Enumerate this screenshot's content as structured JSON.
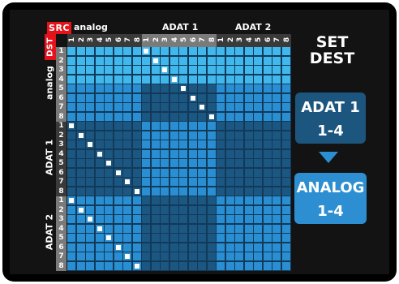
{
  "matrix": {
    "src_label": "SRC",
    "dst_label": "DST",
    "column_groups": [
      {
        "name": "analog",
        "channels": [
          "1",
          "2",
          "3",
          "4",
          "5",
          "6",
          "7",
          "8"
        ]
      },
      {
        "name": "ADAT 1",
        "channels": [
          "1",
          "2",
          "3",
          "4",
          "5",
          "6",
          "7",
          "8"
        ]
      },
      {
        "name": "ADAT 2",
        "channels": [
          "1",
          "2",
          "3",
          "4",
          "5",
          "6",
          "7",
          "8"
        ]
      }
    ],
    "row_groups": [
      {
        "name": "analog",
        "channels": [
          "1",
          "2",
          "3",
          "4",
          "5",
          "6",
          "7",
          "8"
        ]
      },
      {
        "name": "ADAT 1",
        "channels": [
          "1",
          "2",
          "3",
          "4",
          "5",
          "6",
          "7",
          "8"
        ]
      },
      {
        "name": "ADAT 2",
        "channels": [
          "1",
          "2",
          "3",
          "4",
          "5",
          "6",
          "7",
          "8"
        ]
      }
    ],
    "routes": [
      {
        "dest_group": "analog",
        "dest_ch": 1,
        "src_group": "ADAT 1",
        "src_ch": 1
      },
      {
        "dest_group": "analog",
        "dest_ch": 2,
        "src_group": "ADAT 1",
        "src_ch": 2
      },
      {
        "dest_group": "analog",
        "dest_ch": 3,
        "src_group": "ADAT 1",
        "src_ch": 3
      },
      {
        "dest_group": "analog",
        "dest_ch": 4,
        "src_group": "ADAT 1",
        "src_ch": 4
      },
      {
        "dest_group": "analog",
        "dest_ch": 5,
        "src_group": "ADAT 1",
        "src_ch": 5
      },
      {
        "dest_group": "analog",
        "dest_ch": 6,
        "src_group": "ADAT 1",
        "src_ch": 6
      },
      {
        "dest_group": "analog",
        "dest_ch": 7,
        "src_group": "ADAT 1",
        "src_ch": 7
      },
      {
        "dest_group": "analog",
        "dest_ch": 8,
        "src_group": "ADAT 1",
        "src_ch": 8
      },
      {
        "dest_group": "ADAT 1",
        "dest_ch": 1,
        "src_group": "analog",
        "src_ch": 1
      },
      {
        "dest_group": "ADAT 1",
        "dest_ch": 2,
        "src_group": "analog",
        "src_ch": 2
      },
      {
        "dest_group": "ADAT 1",
        "dest_ch": 3,
        "src_group": "analog",
        "src_ch": 3
      },
      {
        "dest_group": "ADAT 1",
        "dest_ch": 4,
        "src_group": "analog",
        "src_ch": 4
      },
      {
        "dest_group": "ADAT 1",
        "dest_ch": 5,
        "src_group": "analog",
        "src_ch": 5
      },
      {
        "dest_group": "ADAT 1",
        "dest_ch": 6,
        "src_group": "analog",
        "src_ch": 6
      },
      {
        "dest_group": "ADAT 1",
        "dest_ch": 7,
        "src_group": "analog",
        "src_ch": 7
      },
      {
        "dest_group": "ADAT 1",
        "dest_ch": 8,
        "src_group": "analog",
        "src_ch": 8
      },
      {
        "dest_group": "ADAT 2",
        "dest_ch": 1,
        "src_group": "analog",
        "src_ch": 1
      },
      {
        "dest_group": "ADAT 2",
        "dest_ch": 2,
        "src_group": "analog",
        "src_ch": 2
      },
      {
        "dest_group": "ADAT 2",
        "dest_ch": 3,
        "src_group": "analog",
        "src_ch": 3
      },
      {
        "dest_group": "ADAT 2",
        "dest_ch": 4,
        "src_group": "analog",
        "src_ch": 4
      },
      {
        "dest_group": "ADAT 2",
        "dest_ch": 5,
        "src_group": "analog",
        "src_ch": 5
      },
      {
        "dest_group": "ADAT 2",
        "dest_ch": 6,
        "src_group": "analog",
        "src_ch": 6
      },
      {
        "dest_group": "ADAT 2",
        "dest_ch": 7,
        "src_group": "analog",
        "src_ch": 7
      },
      {
        "dest_group": "ADAT 2",
        "dest_ch": 8,
        "src_group": "analog",
        "src_ch": 8
      }
    ],
    "highlight": {
      "dest_group": "analog",
      "dest_channels": "1-4"
    },
    "colors": {
      "block_light": "#2a8fd2",
      "block_dark": "#1c5782",
      "highlight": "#40b8ec",
      "gridline": "#11395a",
      "cell_active": "#ffffff",
      "tab_red": "#e3121b",
      "header_gray": "#7a7a7a"
    }
  },
  "side_panel": {
    "title_line1": "SET",
    "title_line2": "DEST",
    "source": {
      "line1": "ADAT 1",
      "line2": "1-4"
    },
    "arrow_icon": "down-triangle-icon",
    "destination": {
      "line1": "ANALOG",
      "line2": "1-4"
    }
  }
}
